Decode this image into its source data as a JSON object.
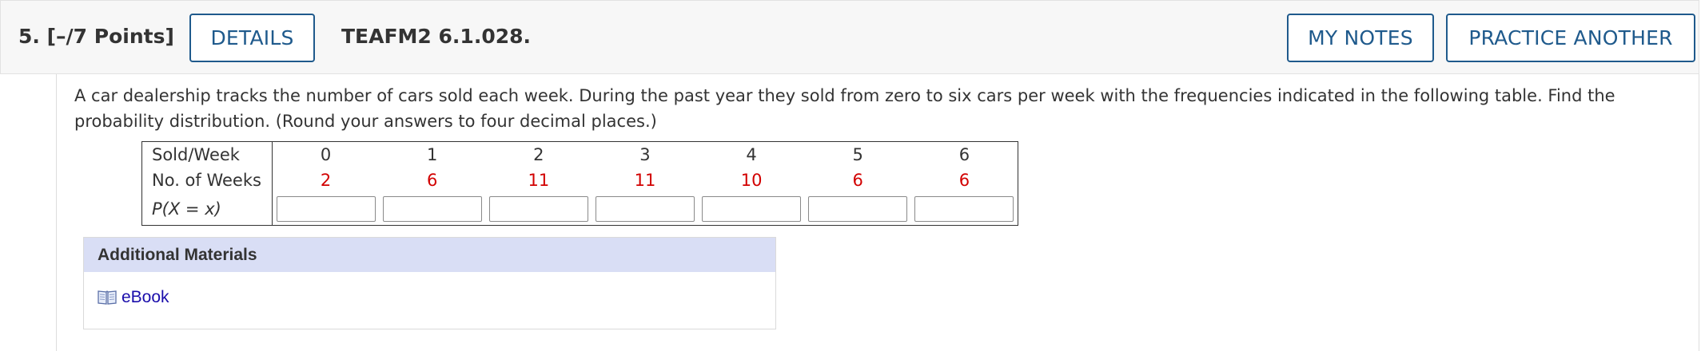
{
  "header": {
    "question_label": "5.  [–/7 Points]",
    "details_label": "DETAILS",
    "problem_code": "TEAFM2 6.1.028.",
    "my_notes_label": "MY NOTES",
    "practice_another_label": "PRACTICE ANOTHER"
  },
  "question": {
    "text": "A car dealership tracks the number of cars sold each week. During the past year they sold from zero to six cars per week with the frequencies indicated in the following table. Find the probability distribution. (Round your answers to four decimal places.)"
  },
  "table": {
    "row_sold_label": "Sold/Week",
    "row_weeks_label": "No. of Weeks",
    "row_prob_label": "P(X = x)",
    "sold": [
      "0",
      "1",
      "2",
      "3",
      "4",
      "5",
      "6"
    ],
    "weeks": [
      "2",
      "6",
      "11",
      "11",
      "10",
      "6",
      "6"
    ]
  },
  "additional_materials": {
    "title": "Additional Materials",
    "ebook_label": "eBook"
  },
  "colors": {
    "accent": "#1f5a8c",
    "given_values": "#d20000",
    "materials_bar": "#d9def5",
    "link": "#1a0dab"
  }
}
